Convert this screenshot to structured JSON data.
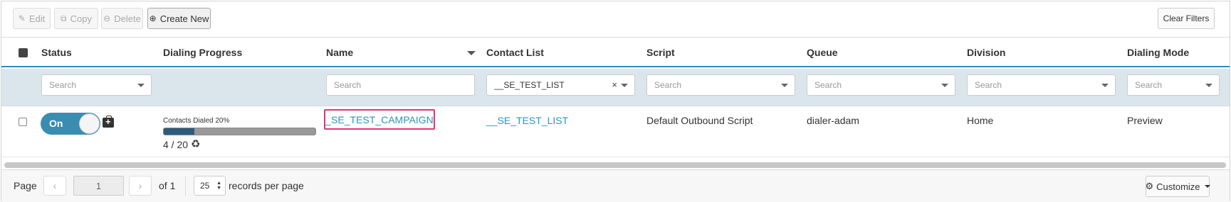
{
  "toolbar": {
    "edit_label": "Edit",
    "copy_label": "Copy",
    "delete_label": "Delete",
    "create_label": "Create New",
    "clear_filters_label": "Clear Filters"
  },
  "columns": {
    "status": "Status",
    "dialing_progress": "Dialing Progress",
    "name": "Name",
    "contact_list": "Contact List",
    "script": "Script",
    "queue": "Queue",
    "division": "Division",
    "dialing_mode": "Dialing Mode"
  },
  "filters": {
    "placeholder": "Search",
    "contact_list_value": "__SE_TEST_LIST"
  },
  "row": {
    "status": "On",
    "progress_label": "Contacts Dialed 20%",
    "progress_fraction": 0.2,
    "progress_count": "4 / 20",
    "name": "_SE_TEST_CAMPAIGN",
    "contact_list": "__SE_TEST_LIST",
    "script": "Default Outbound Script",
    "queue": "dialer-adam",
    "division": "Home",
    "dialing_mode": "Preview"
  },
  "pagination": {
    "page_label": "Page",
    "current_page": "1",
    "of_label": "of 1",
    "per_page": "25",
    "per_page_label": "records per page",
    "customize_label": "Customize"
  },
  "icons": {
    "edit": "pencil-icon",
    "copy": "copy-icon",
    "delete": "minus-circle-icon",
    "create": "plus-circle-icon",
    "kit": "medkit-icon",
    "recycle": "recycle-icon",
    "customize": "gear-icon"
  },
  "colors": {
    "accent": "#2b95c1",
    "toggle": "#3a8cb1",
    "highlight": "#e6317a",
    "filter_bg": "#dae6eb"
  }
}
